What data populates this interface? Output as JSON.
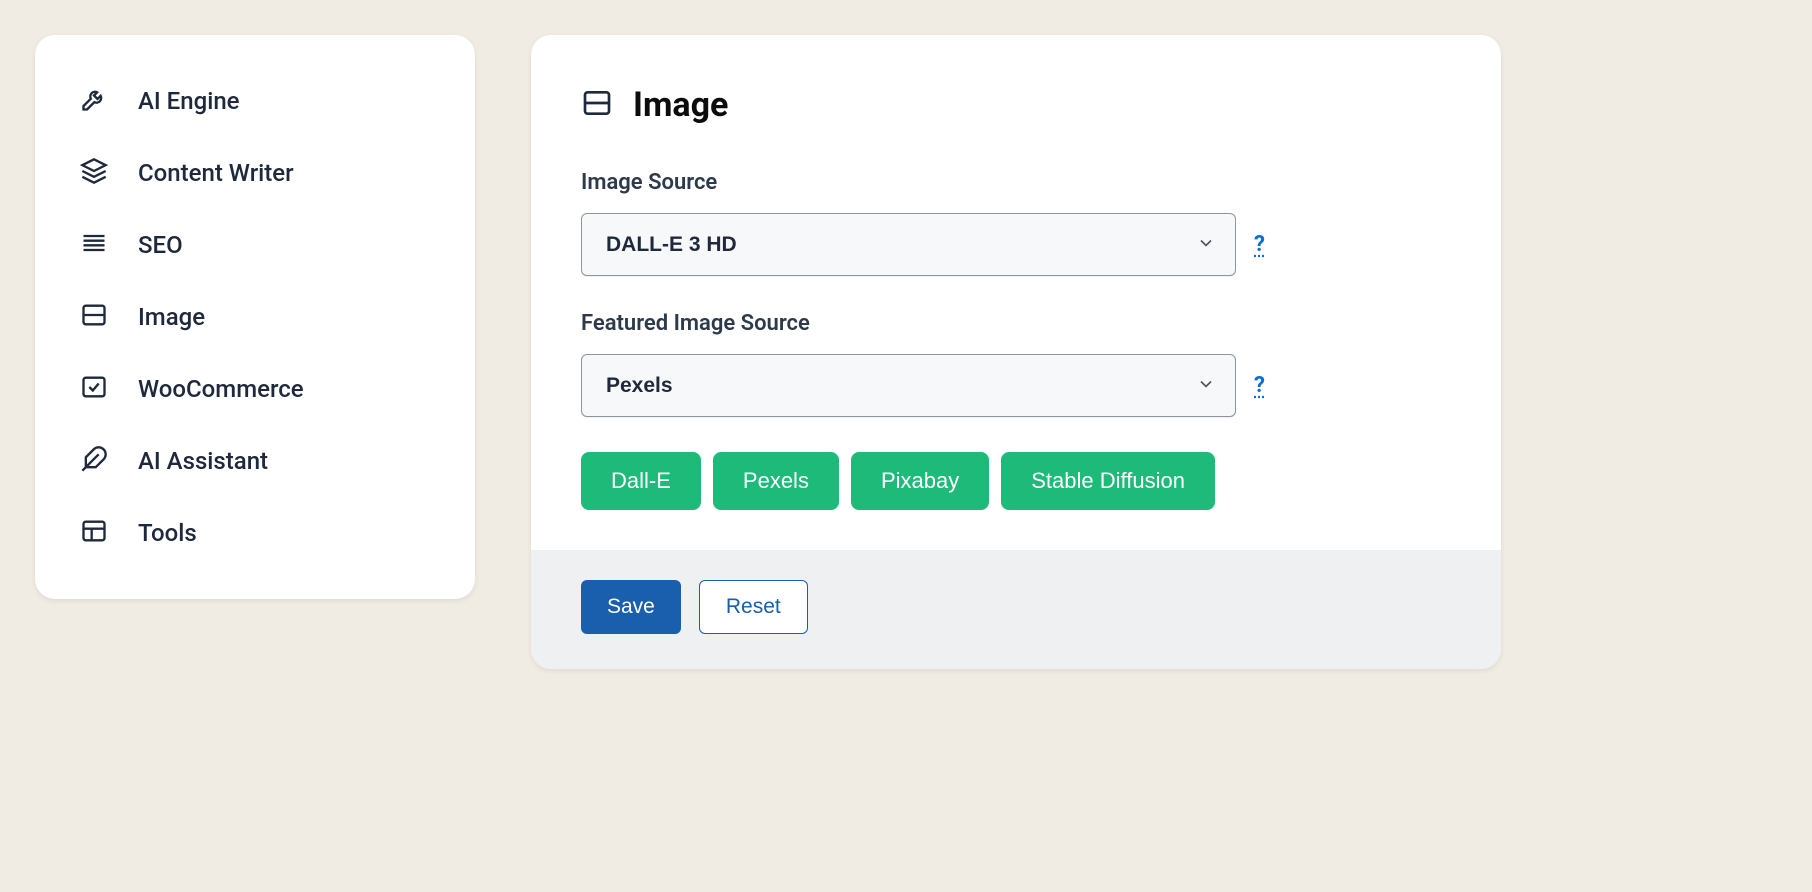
{
  "sidebar": {
    "items": [
      {
        "icon": "wrench-icon",
        "label": "AI Engine"
      },
      {
        "icon": "layers-icon",
        "label": "Content Writer"
      },
      {
        "icon": "lines-icon",
        "label": "SEO"
      },
      {
        "icon": "layout-icon",
        "label": "Image"
      },
      {
        "icon": "check-square-icon",
        "label": "WooCommerce"
      },
      {
        "icon": "feather-icon",
        "label": "AI Assistant"
      },
      {
        "icon": "grid-icon",
        "label": "Tools"
      }
    ]
  },
  "panel": {
    "title": "Image",
    "fields": {
      "image_source": {
        "label": "Image Source",
        "value": "DALL-E 3 HD",
        "help": "?"
      },
      "featured_image_source": {
        "label": "Featured Image Source",
        "value": "Pexels",
        "help": "?"
      }
    },
    "pills": [
      "Dall-E",
      "Pexels",
      "Pixabay",
      "Stable Diffusion"
    ],
    "footer": {
      "save": "Save",
      "reset": "Reset"
    }
  }
}
